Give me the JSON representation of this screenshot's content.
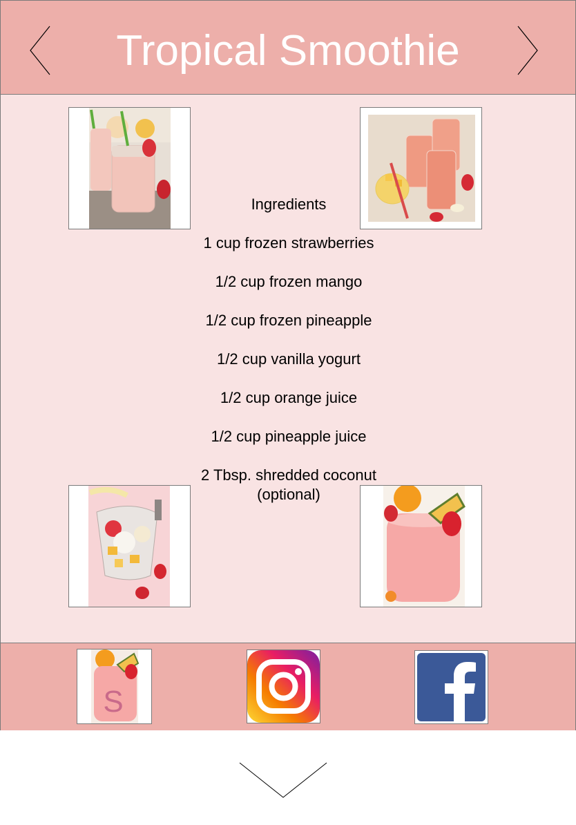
{
  "header": {
    "title": "Tropical Smoothie",
    "prev_icon": "chevron-left-icon",
    "next_icon": "chevron-right-icon"
  },
  "photos": [
    {
      "name": "smoothie-jar-photo"
    },
    {
      "name": "smoothie-glasses-photo"
    },
    {
      "name": "blender-fruit-photo"
    },
    {
      "name": "smoothie-glass-pineapple-photo"
    }
  ],
  "ingredients": {
    "heading": "Ingredients",
    "items": [
      "1 cup frozen strawberries",
      "1/2 cup frozen mango",
      "1/2 cup frozen pineapple",
      "1/2 cup vanilla yogurt",
      "1/2 cup orange juice",
      "1/2 cup pineapple juice",
      "2 Tbsp. shredded coconut (optional)"
    ]
  },
  "footer": {
    "app_icon": "smoothie-app-icon",
    "instagram_icon": "instagram-icon",
    "facebook_icon": "facebook-icon",
    "app_letter": "S"
  },
  "scroll_icon": "chevron-down-icon",
  "colors": {
    "header_bg": "#edafaa",
    "content_bg": "#f9e3e3",
    "title_text": "#ffffff",
    "facebook_blue": "#3b5998"
  }
}
